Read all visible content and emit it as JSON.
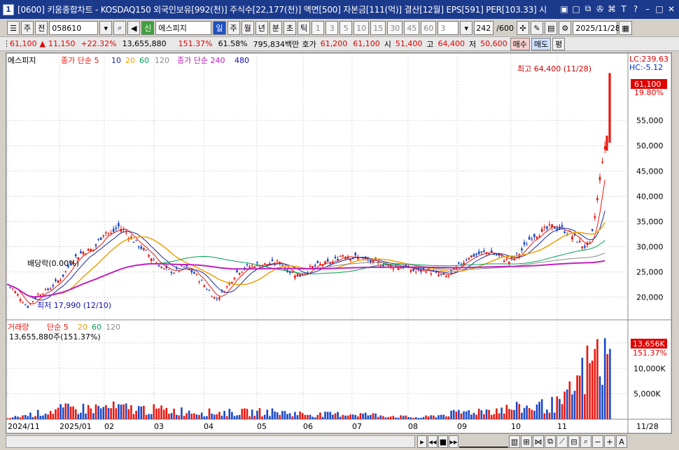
{
  "window": {
    "number": "1",
    "title": "[0600] 키움종합차트 - KOSDAQ150 외국인보유[992(천)] 주식수[22,177(천)] 액면[500] 자본금[111(억)] 결산[12월] EPS[591] PER[103.33] 시"
  },
  "toolbar": {
    "mode_label": "주",
    "prev_label": "전",
    "code": "058610",
    "stock_badge": "신",
    "stock_name": "에스피지",
    "periods": [
      "일",
      "주",
      "월",
      "년",
      "분",
      "초",
      "틱"
    ],
    "active_period": "일",
    "intervals": [
      "1",
      "3",
      "5",
      "10",
      "15",
      "30",
      "45",
      "60"
    ],
    "interval_input": "3",
    "count": "242",
    "count_total": "/600",
    "date": "2025/11/28"
  },
  "infobar": {
    "price": "61,100",
    "change_arrow": "▲",
    "change": "11,150",
    "change_pct": "+22.32%",
    "volume": "13,655,880",
    "vol_ratio": "151.37%",
    "turnover": "61.58%",
    "amount": "795,834백만",
    "bid_label": "호가",
    "bid1": "61,200",
    "bid2": "61,100",
    "open_label": "시",
    "open": "51,400",
    "high_label": "고",
    "high": "64,400",
    "low_label": "저",
    "low": "50,600",
    "buy_label": "매수",
    "sell_label": "매도",
    "flat_label": "평"
  },
  "legend": {
    "name": "에스피지",
    "ma_label": "종가 단순 5",
    "ma_periods": [
      "10",
      "20",
      "60",
      "120"
    ],
    "ma2_label": "종가 단순 240",
    "ma2_period": "480",
    "vol_label": "거래량",
    "vol_ma_label": "단순 5",
    "vol_ma_periods": [
      "20",
      "60",
      "120"
    ],
    "vol_value": "13,655,880주(151.37%)"
  },
  "annotations": {
    "high": "최고 64,400 (11/28)",
    "low": "최저 17,990 (12/10)",
    "dividend": "배당락(0.00%)",
    "lc": "LC:239.63",
    "hc": "HC:-5.12",
    "price_tag": "61,100",
    "pct_tag": "19.80%",
    "vol_tag": "13,656K",
    "vol_pct_tag": "151.37%"
  },
  "colors": {
    "up": "#e8170f",
    "down": "#1a48c8",
    "ma5": "#e8170f",
    "ma10": "#1a2a9a",
    "ma20": "#f0a000",
    "ma60": "#00a050",
    "ma120": "#8a8a8a",
    "ma240": "#c020c0",
    "ma480": "#1010b0"
  },
  "chart_data": {
    "type": "candlestick",
    "price_axis": {
      "labels": [
        "55,000",
        "50,000",
        "45,000",
        "40,000",
        "35,000",
        "30,000",
        "25,000",
        "20,000"
      ],
      "ticks": [
        55000,
        50000,
        45000,
        40000,
        35000,
        30000,
        25000,
        20000
      ],
      "ylim": [
        15500,
        67500
      ]
    },
    "volume_axis": {
      "labels": [
        "15,000K",
        "10,000K",
        "5,000K"
      ],
      "ticks": [
        15000,
        10000,
        5000
      ],
      "ylim": [
        0,
        16500
      ]
    },
    "x_labels": [
      "2024/11",
      "2025/01",
      "02",
      "03",
      "04",
      "05",
      "06",
      "07",
      "08",
      "09",
      "10",
      "11",
      "11/28"
    ],
    "price_series": [
      [
        0,
        22800
      ],
      [
        10,
        21500
      ],
      [
        22,
        19500
      ],
      [
        30,
        18000
      ],
      [
        45,
        20500
      ],
      [
        60,
        21500
      ],
      [
        80,
        24000
      ],
      [
        95,
        27500
      ],
      [
        110,
        29000
      ],
      [
        125,
        29500
      ],
      [
        140,
        33000
      ],
      [
        150,
        32500
      ],
      [
        160,
        34000
      ],
      [
        170,
        33000
      ],
      [
        180,
        31500
      ],
      [
        195,
        29500
      ],
      [
        210,
        27500
      ],
      [
        225,
        25500
      ],
      [
        240,
        25000
      ],
      [
        255,
        26000
      ],
      [
        270,
        24500
      ],
      [
        285,
        22000
      ],
      [
        300,
        19500
      ],
      [
        315,
        22000
      ],
      [
        330,
        25000
      ],
      [
        345,
        26000
      ],
      [
        360,
        26500
      ],
      [
        375,
        26500
      ],
      [
        390,
        27000
      ],
      [
        405,
        25000
      ],
      [
        420,
        24200
      ],
      [
        435,
        25800
      ],
      [
        450,
        26500
      ],
      [
        465,
        26800
      ],
      [
        480,
        28500
      ],
      [
        495,
        28000
      ],
      [
        510,
        27500
      ],
      [
        525,
        26800
      ],
      [
        540,
        26500
      ],
      [
        555,
        26000
      ],
      [
        570,
        26000
      ],
      [
        585,
        25000
      ],
      [
        600,
        25500
      ],
      [
        615,
        24500
      ],
      [
        630,
        24000
      ],
      [
        645,
        26000
      ],
      [
        660,
        28000
      ],
      [
        675,
        28500
      ],
      [
        690,
        29000
      ],
      [
        705,
        28000
      ],
      [
        720,
        27000
      ],
      [
        735,
        29000
      ],
      [
        750,
        32000
      ],
      [
        765,
        33000
      ],
      [
        780,
        34000
      ],
      [
        795,
        33500
      ],
      [
        810,
        32000
      ],
      [
        825,
        30000
      ],
      [
        835,
        30500
      ],
      [
        845,
        40000
      ],
      [
        852,
        48000
      ],
      [
        858,
        50000
      ],
      [
        862,
        64400
      ]
    ],
    "volume_series": [
      [
        0,
        200
      ],
      [
        80,
        2600
      ],
      [
        150,
        3000
      ],
      [
        300,
        1700
      ],
      [
        380,
        1900
      ],
      [
        440,
        1200
      ],
      [
        500,
        1400
      ],
      [
        590,
        400
      ],
      [
        660,
        2000
      ],
      [
        740,
        3000
      ],
      [
        795,
        4000
      ],
      [
        840,
        15500
      ],
      [
        845,
        15900
      ],
      [
        864,
        13656
      ]
    ]
  }
}
